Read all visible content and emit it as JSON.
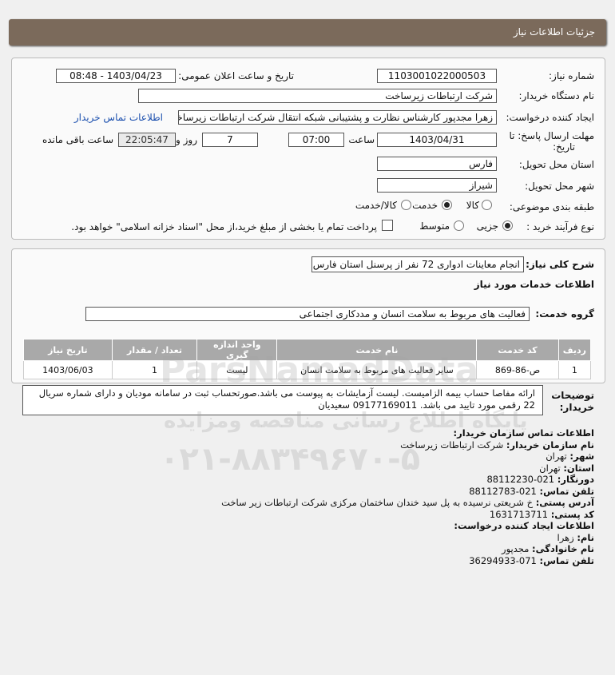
{
  "header": {
    "title": "جزئیات اطلاعات نیاز"
  },
  "form": {
    "need_number_label": "شماره نیاز:",
    "need_number": "1103001022000503",
    "announce_label": "تاریخ و ساعت اعلان عمومی:",
    "announce_value": "1403/04/23 - 08:48",
    "buyer_org_label": "نام دستگاه خریدار:",
    "buyer_org": "شرکت ارتباطات زیرساخت",
    "creator_label": "ایجاد کننده درخواست:",
    "creator": "زهرا مجدپور کارشناس نظارت و پشتیبانی شبکه انتقال شرکت ارتباطات زیرساخت",
    "contact_link": "اطلاعات تماس خریدار",
    "deadline_label": "مهلت ارسال پاسخ: تا",
    "deadline_label2": "تاریخ:",
    "deadline_date": "1403/04/31",
    "time_label": "ساعت",
    "deadline_time": "07:00",
    "days": "7",
    "days_label": "روز و",
    "remaining_time": "22:05:47",
    "remaining_label": "ساعت باقی مانده",
    "province_label": "استان محل تحویل:",
    "province": "فارس",
    "city_label": "شهر محل تحویل:",
    "city": "شیراز",
    "category_label": "طبقه بندی موضوعی:",
    "category_options": [
      "کالا",
      "خدمت",
      "کالا/خدمت"
    ],
    "category_selected": "خدمت",
    "process_label": "نوع فرآیند خرید :",
    "process_options": [
      "جزیی",
      "متوسط"
    ],
    "process_selected": "جزیی",
    "payment_note": "پرداخت تمام یا بخشی از مبلغ خرید،از محل \"اسناد خزانه اسلامی\" خواهد بود."
  },
  "summary": {
    "label": "شرح کلی نیاز:",
    "value": "انجام معاینات ادواری 72 نفر از پرسنل استان فارس",
    "services_title": "اطلاعات خدمات مورد نیاز",
    "group_label": "گروه خدمت:",
    "group_value": "فعالیت های مربوط به سلامت انسان و مددکاری اجتماعی"
  },
  "table": {
    "headers": [
      "ردیف",
      "کد خدمت",
      "نام خدمت",
      "واحد اندازه گیری",
      "تعداد / مقدار",
      "تاریخ نیاز"
    ],
    "rows": [
      [
        "1",
        "ص-86-869",
        "سایر فعالیت های مربوط به سلامت انسان",
        "لیست",
        "1",
        "1403/06/03"
      ]
    ]
  },
  "notes": {
    "label": "توضیحات خریدار:",
    "text": "ارائه مفاصا حساب بیمه الزامیست. لیست آزمایشات به پیوست می باشد.صورتحساب ثبت در سامانه مودیان و دارای شماره سریال 22 رقمی مورد تایید می باشد. 09177169011 سعیدیان"
  },
  "contact": {
    "title": "اطلاعات تماس سازمان خریدار:",
    "org_label": "نام سازمان خریدار:",
    "org": "شرکت ارتباطات زیرساخت",
    "city_label": "شهر:",
    "city": "تهران",
    "province_label": "استان:",
    "province": "تهران",
    "fax_label": "دورنگار:",
    "fax": "021-88112230",
    "phone_label": "تلفن تماس:",
    "phone": "021-88112783",
    "address_label": "آدرس پستی:",
    "address": "خ شریعتی نرسیده به پل سید خندان ساختمان مرکزی شرکت ارتباطات زیر ساخت",
    "postal_label": "کد پستی:",
    "postal": "1631713711",
    "creator_title": "اطلاعات ایجاد کننده درخواست:",
    "name_label": "نام:",
    "name": "زهرا",
    "family_label": "نام خانوادگی:",
    "family": "مجدپور",
    "cphone_label": "تلفن تماس:",
    "cphone": "071-36294933"
  },
  "watermark": {
    "site": "ParsNamadData",
    "slogan": "پایگاه اطلاع رسانی مناقصه ومزایده",
    "phone": "۰۲۱-۸۸۳۴۹۶۷۰-۵"
  }
}
